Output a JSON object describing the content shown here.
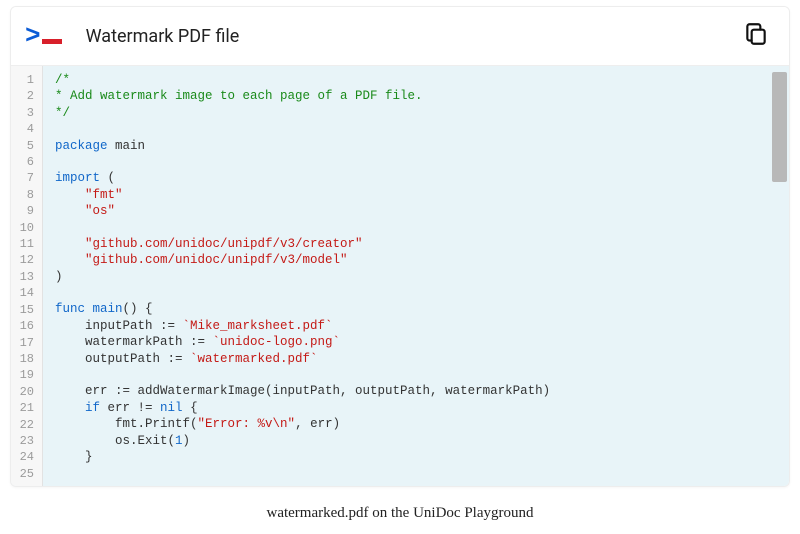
{
  "header": {
    "title": "Watermark PDF file"
  },
  "caption": "watermarked.pdf on the UniDoc Playground",
  "code": {
    "lines": [
      [
        {
          "cls": "tok-comment",
          "t": "/*"
        }
      ],
      [
        {
          "cls": "tok-comment",
          "t": "* Add watermark image to each page of a PDF file."
        }
      ],
      [
        {
          "cls": "tok-comment",
          "t": "*/"
        }
      ],
      [],
      [
        {
          "cls": "tok-keyword",
          "t": "package"
        },
        {
          "cls": "tok-ident",
          "t": " main"
        }
      ],
      [],
      [
        {
          "cls": "tok-keyword",
          "t": "import"
        },
        {
          "cls": "tok-punct",
          "t": " ("
        }
      ],
      [
        {
          "cls": "",
          "t": "    "
        },
        {
          "cls": "tok-string",
          "t": "\"fmt\""
        }
      ],
      [
        {
          "cls": "",
          "t": "    "
        },
        {
          "cls": "tok-string",
          "t": "\"os\""
        }
      ],
      [],
      [
        {
          "cls": "",
          "t": "    "
        },
        {
          "cls": "tok-string",
          "t": "\"github.com/unidoc/unipdf/v3/creator\""
        }
      ],
      [
        {
          "cls": "",
          "t": "    "
        },
        {
          "cls": "tok-string",
          "t": "\"github.com/unidoc/unipdf/v3/model\""
        }
      ],
      [
        {
          "cls": "tok-punct",
          "t": ")"
        }
      ],
      [],
      [
        {
          "cls": "tok-keyword",
          "t": "func"
        },
        {
          "cls": "tok-ident",
          "t": " "
        },
        {
          "cls": "tok-func",
          "t": "main"
        },
        {
          "cls": "tok-punct",
          "t": "() {"
        }
      ],
      [
        {
          "cls": "",
          "t": "    inputPath := "
        },
        {
          "cls": "tok-string",
          "t": "`Mike_marksheet.pdf`"
        }
      ],
      [
        {
          "cls": "",
          "t": "    watermarkPath := "
        },
        {
          "cls": "tok-string",
          "t": "`unidoc-logo.png`"
        }
      ],
      [
        {
          "cls": "",
          "t": "    outputPath := "
        },
        {
          "cls": "tok-string",
          "t": "`watermarked.pdf`"
        }
      ],
      [],
      [
        {
          "cls": "",
          "t": "    err := addWatermarkImage(inputPath, outputPath, watermarkPath)"
        }
      ],
      [
        {
          "cls": "",
          "t": "    "
        },
        {
          "cls": "tok-keyword",
          "t": "if"
        },
        {
          "cls": "",
          "t": " err != "
        },
        {
          "cls": "tok-keyword",
          "t": "nil"
        },
        {
          "cls": "",
          "t": " {"
        }
      ],
      [
        {
          "cls": "",
          "t": "        fmt.Printf("
        },
        {
          "cls": "tok-string",
          "t": "\"Error: %v\\n\""
        },
        {
          "cls": "",
          "t": ", err)"
        }
      ],
      [
        {
          "cls": "",
          "t": "        os.Exit("
        },
        {
          "cls": "tok-number",
          "t": "1"
        },
        {
          "cls": "",
          "t": ")"
        }
      ],
      [
        {
          "cls": "",
          "t": "    }"
        }
      ],
      []
    ]
  }
}
